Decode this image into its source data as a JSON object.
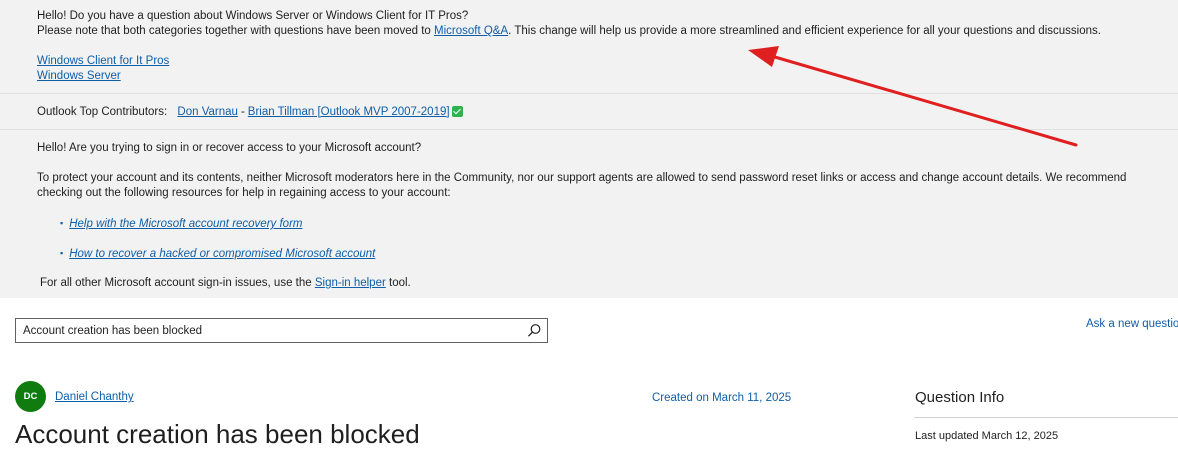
{
  "banner": {
    "intro_line1": "Hello! Do you have a question about Windows Server or Windows Client for IT Pros?",
    "intro_line2_before": "Please note that both categories together with questions have been moved to ",
    "intro_link": "Microsoft Q&A",
    "intro_line2_after": ". This change will help us provide a more streamlined and efficient experience for all your questions and discussions.",
    "category_links": [
      "Windows Client for It Pros",
      "Windows Server"
    ],
    "contributors_label": "Outlook Top Contributors:",
    "contributors": [
      "Don Varnau",
      "Brian Tillman [Outlook MVP 2007-2019]"
    ],
    "contributor_sep": "-",
    "signin_question": "Hello! Are you trying to sign in or recover access to your Microsoft account?",
    "protect_text": "To protect your account and its contents, neither Microsoft moderators here in the Community, nor our support agents are allowed to send password reset links or access and change account details. We recommend checking out the following resources for help in regaining access to your account:",
    "resources": [
      "Help with the Microsoft account recovery form",
      "How to recover a hacked or compromised Microsoft account"
    ],
    "other_before": "For all other Microsoft account sign-in issues, use the ",
    "other_link": "Sign-in helper",
    "other_after": " tool."
  },
  "search": {
    "value": "Account creation has been blocked"
  },
  "ask_link": "Ask a new question",
  "post": {
    "avatar_initials": "DC",
    "author": "Daniel Chanthy",
    "created": "Created on March 11, 2025",
    "title": "Account creation has been blocked"
  },
  "info": {
    "heading": "Question Info",
    "updated": "Last updated March 12, 2025"
  },
  "colors": {
    "link": "#0f5ea8",
    "avatar_bg": "#107c10",
    "annotation_arrow": "#e02020",
    "verified_badge": "#2fb24c"
  },
  "icons": {
    "search": "search-icon",
    "verified": "verified-check-icon"
  }
}
